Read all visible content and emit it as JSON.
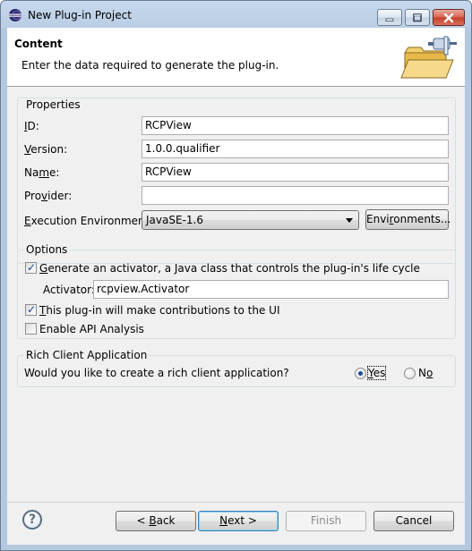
{
  "window": {
    "title": "New Plug-in Project"
  },
  "header": {
    "title": "Content",
    "description": "Enter the data required to generate the plug-in."
  },
  "properties": {
    "group_label": "Properties",
    "id_label_prefix": "I",
    "id_label_rest": "D:",
    "id_value": "RCPView",
    "version_label_prefix": "V",
    "version_label_rest": "ersion:",
    "version_value": "1.0.0.qualifier",
    "name_label_pre": "Na",
    "name_label_mn": "m",
    "name_label_rest": "e:",
    "name_value": "RCPView",
    "provider_label_pre": "Pro",
    "provider_label_v": "v",
    "provider_label_rest": "ider:",
    "provider_value": "",
    "env_label_prefix": "E",
    "env_label_rest": "xecution Environment:",
    "env_value": "JavaSE-1.6",
    "environments_button_pre": "Envi",
    "environments_button_mn": "r",
    "environments_button_rest": "onments..."
  },
  "options": {
    "group_label": "Options",
    "activator_check_label_pre": "",
    "activator_check_label_mn": "G",
    "activator_check_label_rest": "enerate an activator, a Java class that controls the plug-in's life cycle",
    "activator_checked": true,
    "activator_label": "Activator:",
    "activator_value": "rcpview.Activator",
    "ui_check_label_mn": "T",
    "ui_check_label_rest": "his plug-in will make contributions to the UI",
    "ui_checked": true,
    "api_check_label": "Enable API Analysis",
    "api_checked": false
  },
  "rca": {
    "group_label": "Rich Client Application",
    "question": "Would you like to create a rich client application?",
    "yes_mn": "Y",
    "yes_rest": "es",
    "no_pre": "N",
    "no_mn": "o",
    "selected": "yes"
  },
  "footer": {
    "help_glyph": "?",
    "back_pre": "< ",
    "back_mn": "B",
    "back_rest": "ack",
    "next_mn": "N",
    "next_rest": "ext >",
    "finish_label": "Finish",
    "cancel_label": "Cancel"
  },
  "colors": {
    "accent": "#3c7fb1",
    "titlebar": "#c6d8ec"
  }
}
